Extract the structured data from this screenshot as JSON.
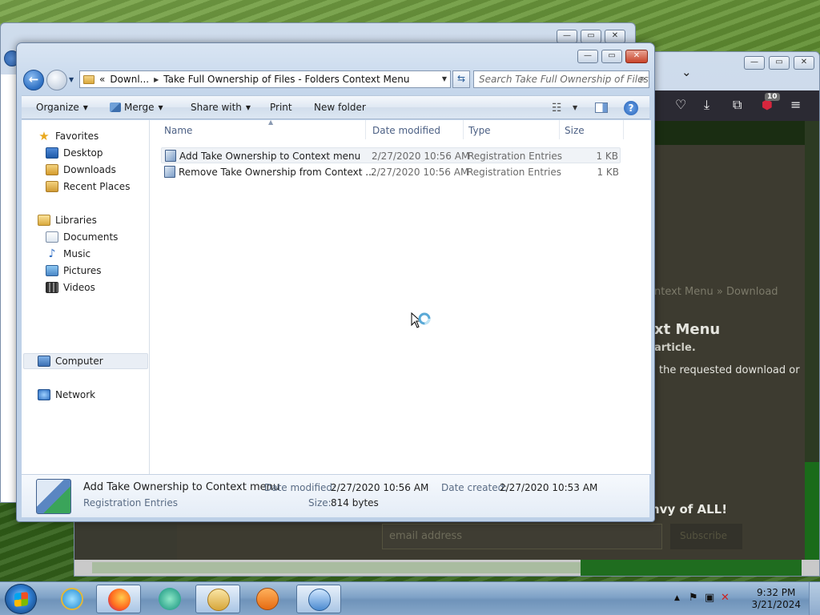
{
  "explorer": {
    "address": {
      "chevron": "«",
      "segments": [
        "Downl...",
        "Take Full Ownership of Files - Folders Context Menu"
      ]
    },
    "search_placeholder": "Search Take Full Ownership of Files - ...",
    "toolbar": {
      "organize": "Organize",
      "merge": "Merge",
      "share_with": "Share with",
      "print": "Print",
      "new_folder": "New folder"
    },
    "nav": {
      "favorites": "Favorites",
      "desktop": "Desktop",
      "downloads": "Downloads",
      "recent_places": "Recent Places",
      "libraries": "Libraries",
      "documents": "Documents",
      "music": "Music",
      "pictures": "Pictures",
      "videos": "Videos",
      "computer": "Computer",
      "network": "Network"
    },
    "columns": {
      "name": "Name",
      "date_modified": "Date modified",
      "type": "Type",
      "size": "Size"
    },
    "files": [
      {
        "name": "Add Take Ownership to Context menu",
        "date": "2/27/2020 10:56 AM",
        "type": "Registration Entries",
        "size": "1 KB"
      },
      {
        "name": "Remove Take Ownership from Context ...",
        "date": "2/27/2020 10:56 AM",
        "type": "Registration Entries",
        "size": "1 KB"
      }
    ],
    "details": {
      "name": "Add Take Ownership to Context menu",
      "type": "Registration Entries",
      "date_modified_label": "Date modified:",
      "date_modified": "2/27/2020 10:56 AM",
      "date_created_label": "Date created:",
      "date_created": "2/27/2020 10:53 AM",
      "size_label": "Size:",
      "size": "814 bytes"
    }
  },
  "browser": {
    "badge_count": "10",
    "breadcrumb_fragment": "ntext Menu » Download",
    "heading_fragment": "xt Menu",
    "subheading_fragment": "article.",
    "paragraph_fragment": "the requested download or",
    "envy_fragment": "nvy of ALL!",
    "email_placeholder": "email address",
    "subscribe_label": "Subscribe"
  },
  "taskbar": {
    "time": "9:32 PM",
    "date": "3/21/2024",
    "apps": [
      "internet-explorer",
      "firefox",
      "glary",
      "file-explorer",
      "media-player",
      "registry-cleaner"
    ]
  },
  "colors": {
    "explorer_chrome": "#c2d4ea",
    "selection": "#e9eef5",
    "browser_toolbar": "#2b2a33",
    "taskbar": "#7fa2c7"
  }
}
